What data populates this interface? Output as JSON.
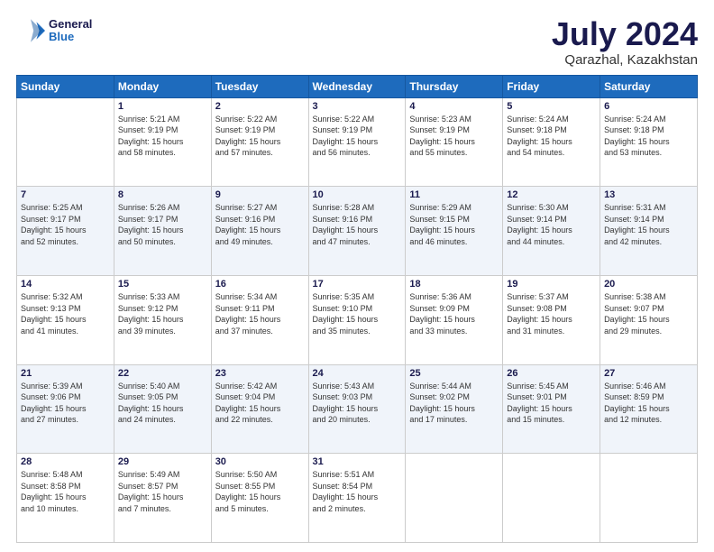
{
  "header": {
    "logo": {
      "general": "General",
      "blue": "Blue"
    },
    "title": "July 2024",
    "location": "Qarazhal, Kazakhstan"
  },
  "weekdays": [
    "Sunday",
    "Monday",
    "Tuesday",
    "Wednesday",
    "Thursday",
    "Friday",
    "Saturday"
  ],
  "weeks": [
    [
      {
        "num": "",
        "info": ""
      },
      {
        "num": "1",
        "info": "Sunrise: 5:21 AM\nSunset: 9:19 PM\nDaylight: 15 hours\nand 58 minutes."
      },
      {
        "num": "2",
        "info": "Sunrise: 5:22 AM\nSunset: 9:19 PM\nDaylight: 15 hours\nand 57 minutes."
      },
      {
        "num": "3",
        "info": "Sunrise: 5:22 AM\nSunset: 9:19 PM\nDaylight: 15 hours\nand 56 minutes."
      },
      {
        "num": "4",
        "info": "Sunrise: 5:23 AM\nSunset: 9:19 PM\nDaylight: 15 hours\nand 55 minutes."
      },
      {
        "num": "5",
        "info": "Sunrise: 5:24 AM\nSunset: 9:18 PM\nDaylight: 15 hours\nand 54 minutes."
      },
      {
        "num": "6",
        "info": "Sunrise: 5:24 AM\nSunset: 9:18 PM\nDaylight: 15 hours\nand 53 minutes."
      }
    ],
    [
      {
        "num": "7",
        "info": "Sunrise: 5:25 AM\nSunset: 9:17 PM\nDaylight: 15 hours\nand 52 minutes."
      },
      {
        "num": "8",
        "info": "Sunrise: 5:26 AM\nSunset: 9:17 PM\nDaylight: 15 hours\nand 50 minutes."
      },
      {
        "num": "9",
        "info": "Sunrise: 5:27 AM\nSunset: 9:16 PM\nDaylight: 15 hours\nand 49 minutes."
      },
      {
        "num": "10",
        "info": "Sunrise: 5:28 AM\nSunset: 9:16 PM\nDaylight: 15 hours\nand 47 minutes."
      },
      {
        "num": "11",
        "info": "Sunrise: 5:29 AM\nSunset: 9:15 PM\nDaylight: 15 hours\nand 46 minutes."
      },
      {
        "num": "12",
        "info": "Sunrise: 5:30 AM\nSunset: 9:14 PM\nDaylight: 15 hours\nand 44 minutes."
      },
      {
        "num": "13",
        "info": "Sunrise: 5:31 AM\nSunset: 9:14 PM\nDaylight: 15 hours\nand 42 minutes."
      }
    ],
    [
      {
        "num": "14",
        "info": "Sunrise: 5:32 AM\nSunset: 9:13 PM\nDaylight: 15 hours\nand 41 minutes."
      },
      {
        "num": "15",
        "info": "Sunrise: 5:33 AM\nSunset: 9:12 PM\nDaylight: 15 hours\nand 39 minutes."
      },
      {
        "num": "16",
        "info": "Sunrise: 5:34 AM\nSunset: 9:11 PM\nDaylight: 15 hours\nand 37 minutes."
      },
      {
        "num": "17",
        "info": "Sunrise: 5:35 AM\nSunset: 9:10 PM\nDaylight: 15 hours\nand 35 minutes."
      },
      {
        "num": "18",
        "info": "Sunrise: 5:36 AM\nSunset: 9:09 PM\nDaylight: 15 hours\nand 33 minutes."
      },
      {
        "num": "19",
        "info": "Sunrise: 5:37 AM\nSunset: 9:08 PM\nDaylight: 15 hours\nand 31 minutes."
      },
      {
        "num": "20",
        "info": "Sunrise: 5:38 AM\nSunset: 9:07 PM\nDaylight: 15 hours\nand 29 minutes."
      }
    ],
    [
      {
        "num": "21",
        "info": "Sunrise: 5:39 AM\nSunset: 9:06 PM\nDaylight: 15 hours\nand 27 minutes."
      },
      {
        "num": "22",
        "info": "Sunrise: 5:40 AM\nSunset: 9:05 PM\nDaylight: 15 hours\nand 24 minutes."
      },
      {
        "num": "23",
        "info": "Sunrise: 5:42 AM\nSunset: 9:04 PM\nDaylight: 15 hours\nand 22 minutes."
      },
      {
        "num": "24",
        "info": "Sunrise: 5:43 AM\nSunset: 9:03 PM\nDaylight: 15 hours\nand 20 minutes."
      },
      {
        "num": "25",
        "info": "Sunrise: 5:44 AM\nSunset: 9:02 PM\nDaylight: 15 hours\nand 17 minutes."
      },
      {
        "num": "26",
        "info": "Sunrise: 5:45 AM\nSunset: 9:01 PM\nDaylight: 15 hours\nand 15 minutes."
      },
      {
        "num": "27",
        "info": "Sunrise: 5:46 AM\nSunset: 8:59 PM\nDaylight: 15 hours\nand 12 minutes."
      }
    ],
    [
      {
        "num": "28",
        "info": "Sunrise: 5:48 AM\nSunset: 8:58 PM\nDaylight: 15 hours\nand 10 minutes."
      },
      {
        "num": "29",
        "info": "Sunrise: 5:49 AM\nSunset: 8:57 PM\nDaylight: 15 hours\nand 7 minutes."
      },
      {
        "num": "30",
        "info": "Sunrise: 5:50 AM\nSunset: 8:55 PM\nDaylight: 15 hours\nand 5 minutes."
      },
      {
        "num": "31",
        "info": "Sunrise: 5:51 AM\nSunset: 8:54 PM\nDaylight: 15 hours\nand 2 minutes."
      },
      {
        "num": "",
        "info": ""
      },
      {
        "num": "",
        "info": ""
      },
      {
        "num": "",
        "info": ""
      }
    ]
  ]
}
